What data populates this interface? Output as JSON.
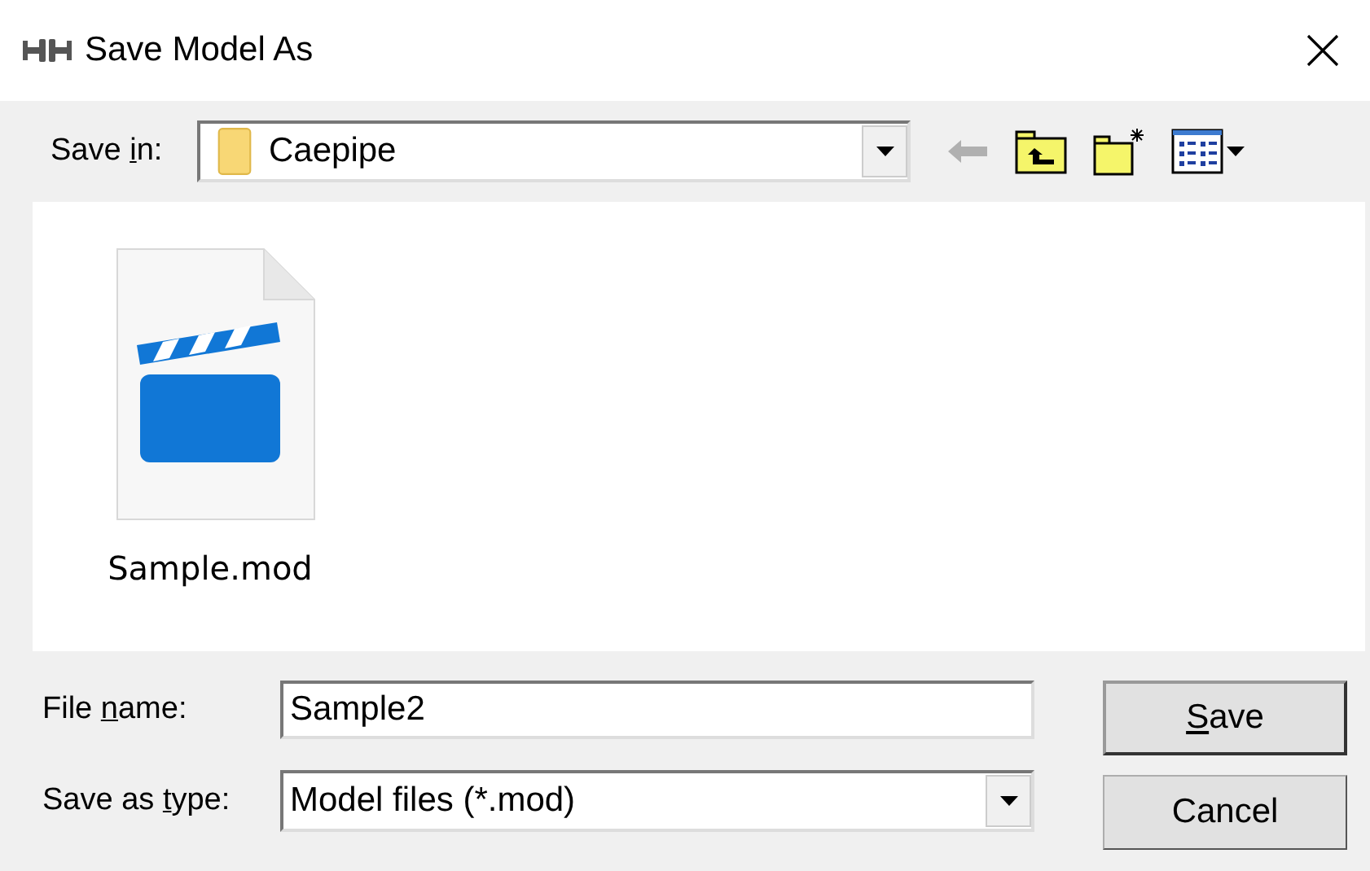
{
  "window": {
    "title": "Save Model As"
  },
  "save_in": {
    "label_parts": {
      "before": "Save ",
      "key": "i",
      "after": "n:"
    },
    "value": "Caepipe"
  },
  "toolbar": {
    "back_disabled": true
  },
  "files": [
    {
      "name": "Sample.mod",
      "selected": false
    }
  ],
  "file_name": {
    "label_parts": {
      "before": "File ",
      "key": "n",
      "after": "ame:"
    },
    "value": "Sample2"
  },
  "save_as_type": {
    "label_parts": {
      "before": "Save as ",
      "key": "t",
      "after": "ype:"
    },
    "value": "Model files (*.mod)"
  },
  "buttons": [
    {
      "kind": "default",
      "label_parts": {
        "key": "S",
        "after": "ave"
      }
    },
    {
      "kind": "normal",
      "label_parts": {
        "before": "Cancel"
      }
    }
  ]
}
